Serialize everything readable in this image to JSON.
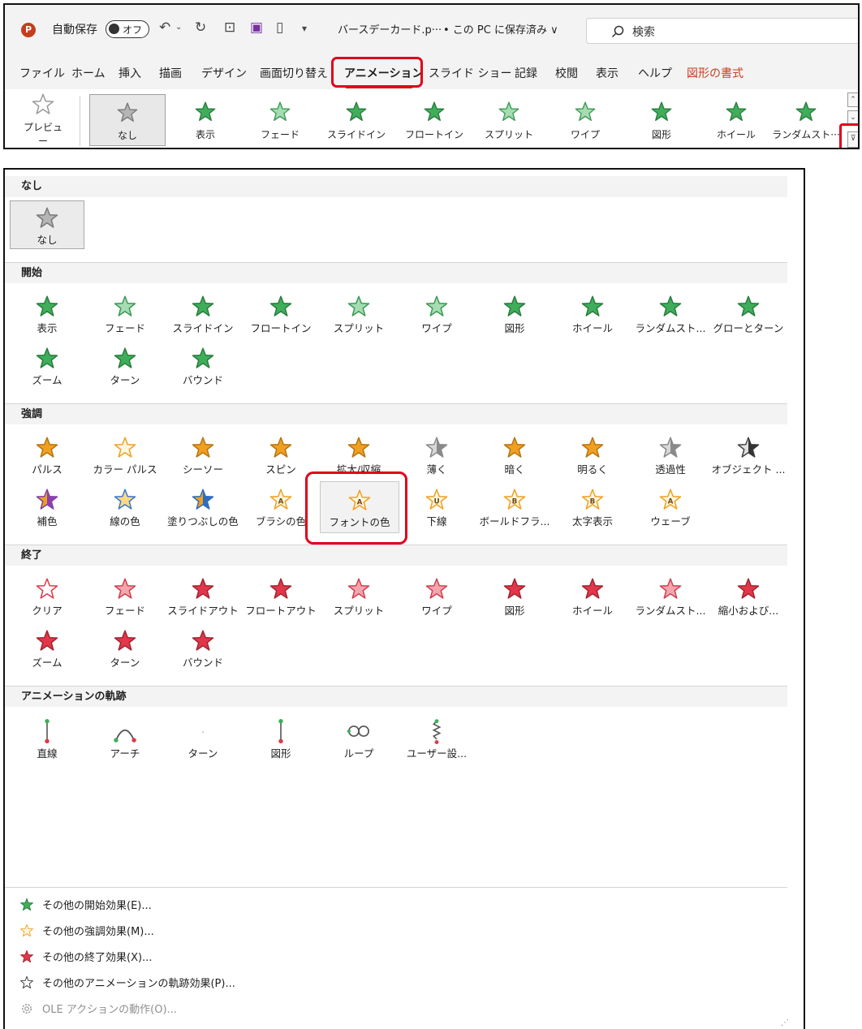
{
  "app": {
    "logo_letter": "P",
    "autosave_label": "自動保存",
    "autosave_state": "オフ",
    "file_name": "バースデーカード.p···",
    "save_status": "• この PC に保存済み ∨",
    "search_placeholder": "検索"
  },
  "tabs": [
    {
      "label": "ファイル"
    },
    {
      "label": "ホーム"
    },
    {
      "label": "挿入"
    },
    {
      "label": "描画"
    },
    {
      "label": "デザイン"
    },
    {
      "label": "画面切り替え"
    },
    {
      "label": "アニメーション"
    },
    {
      "label": "スライド ショー"
    },
    {
      "label": "記録"
    },
    {
      "label": "校閲"
    },
    {
      "label": "表示"
    },
    {
      "label": "ヘルプ"
    },
    {
      "label": "図形の書式"
    }
  ],
  "ribbon": {
    "preview_label": "プレビュー",
    "gallery": [
      {
        "label": "なし"
      },
      {
        "label": "表示"
      },
      {
        "label": "フェード"
      },
      {
        "label": "スライドイン"
      },
      {
        "label": "フロートイン"
      },
      {
        "label": "スプリット"
      },
      {
        "label": "ワイプ"
      },
      {
        "label": "図形"
      },
      {
        "label": "ホイール"
      },
      {
        "label": "ランダムスト···"
      }
    ]
  },
  "panel": {
    "none_section": {
      "title": "なし",
      "item": "なし"
    },
    "entrance": {
      "title": "開始",
      "items": [
        "表示",
        "フェード",
        "スライドイン",
        "フロートイン",
        "スプリット",
        "ワイプ",
        "図形",
        "ホイール",
        "ランダムスト...",
        "グローとターン",
        "ズーム",
        "ターン",
        "バウンド"
      ]
    },
    "emphasis": {
      "title": "強調",
      "items": [
        "パルス",
        "カラー パルス",
        "シーソー",
        "スピン",
        "拡大/収縮",
        "薄く",
        "暗く",
        "明るく",
        "透過性",
        "オブジェクト ...",
        "補色",
        "線の色",
        "塗りつぶしの色",
        "ブラシの色",
        "フォントの色",
        "下線",
        "ボールドフラ...",
        "太字表示",
        "ウェーブ"
      ]
    },
    "exit": {
      "title": "終了",
      "items": [
        "クリア",
        "フェード",
        "スライドアウト",
        "フロートアウト",
        "スプリット",
        "ワイプ",
        "図形",
        "ホイール",
        "ランダムスト...",
        "縮小および...",
        "ズーム",
        "ターン",
        "バウンド"
      ]
    },
    "paths": {
      "title": "アニメーションの軌跡",
      "items": [
        "直線",
        "アーチ",
        "ターン",
        "図形",
        "ループ",
        "ユーザー設..."
      ]
    },
    "more": [
      {
        "label": "その他の開始効果(E)..."
      },
      {
        "label": "その他の強調効果(M)..."
      },
      {
        "label": "その他の終了効果(X)..."
      },
      {
        "label": "その他のアニメーションの軌跡効果(P)..."
      },
      {
        "label": "OLE アクションの動作(O)..."
      }
    ]
  },
  "colors": {
    "entrance_green": "#3fae5a",
    "emphasis_orange": "#f0a020",
    "exit_red": "#e0384a",
    "highlight_red": "#e0001b",
    "accent_brand": "#c43e1c"
  }
}
